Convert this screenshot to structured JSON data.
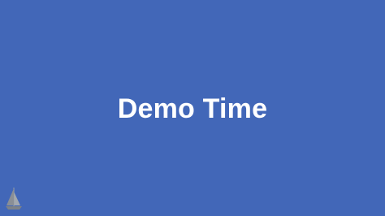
{
  "slide": {
    "title": "Demo Time",
    "background_color": "#4267b8",
    "text_color": "#ffffff",
    "logo_icon": "sailboat-icon",
    "logo_color": "#8a8f96"
  }
}
